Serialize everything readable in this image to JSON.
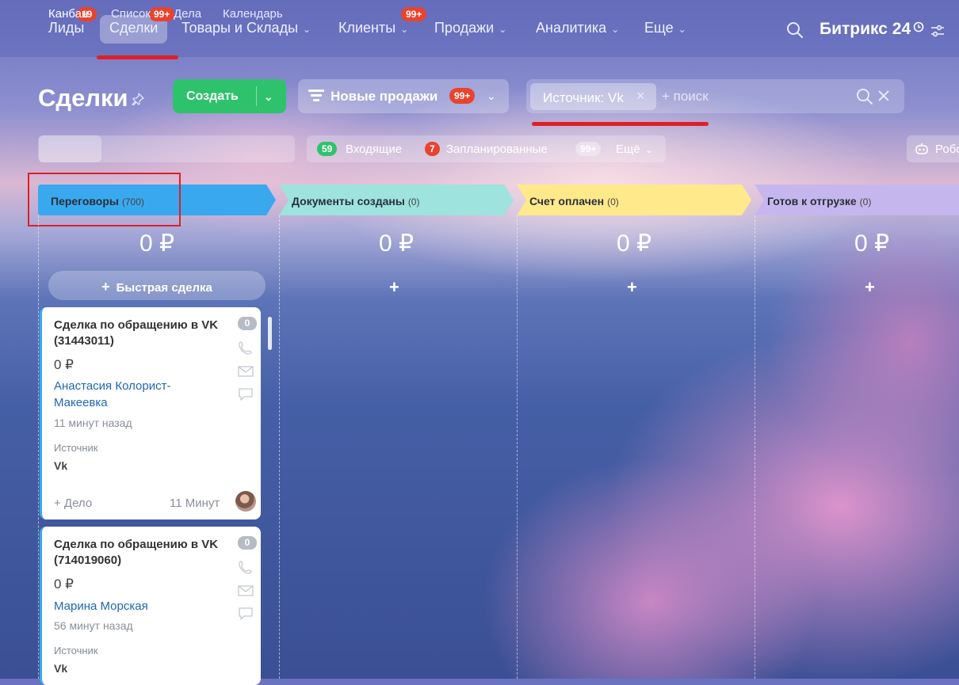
{
  "nav": {
    "items": [
      {
        "label": "Лиды",
        "badge": "19",
        "chevron": false
      },
      {
        "label": "Сделки",
        "badge": "99+",
        "chevron": false,
        "active": true
      },
      {
        "label": "Товары и Склады",
        "badge": "",
        "chevron": true
      },
      {
        "label": "Клиенты",
        "badge": "99+",
        "chevron": true
      },
      {
        "label": "Продажи",
        "badge": "",
        "chevron": true
      },
      {
        "label": "Аналитика",
        "badge": "",
        "chevron": true
      },
      {
        "label": "Еще",
        "badge": "",
        "chevron": true
      }
    ],
    "logo": "Битрикс 24",
    "icons": [
      "search-icon",
      "clock-icon",
      "settings-sliders-icon"
    ]
  },
  "toolbar": {
    "title": "Сделки",
    "create_label": "Создать",
    "funnel_label": "Новые продажи",
    "funnel_badge": "99+",
    "filter_tag": "Источник: Vk",
    "search_placeholder": "+ поиск"
  },
  "views": {
    "tabs": [
      "Канбан",
      "Список",
      "Дела",
      "Календарь"
    ],
    "active": "Канбан"
  },
  "counters": {
    "incoming_count": "59",
    "incoming_label": "Входящие",
    "planned_count": "7",
    "planned_label": "Запланированные",
    "more_count": "99+",
    "more_label": "Ещё",
    "robots_label": "Робо"
  },
  "stages": [
    {
      "name": "Переговоры",
      "count": "(700)",
      "sum": "0 ₽",
      "color": "#39a8ef"
    },
    {
      "name": "Документы созданы",
      "count": "(0)",
      "sum": "0 ₽",
      "color": "#9ee3dd"
    },
    {
      "name": "Счет оплачен",
      "count": "(0)",
      "sum": "0 ₽",
      "color": "#ffe98a"
    },
    {
      "name": "Готов к отгрузке",
      "count": "(0)",
      "sum": "0 ₽",
      "color": "#c6b6ee"
    }
  ],
  "quick_deal_label": "Быстрая сделка",
  "cards": [
    {
      "title": "Сделка по обращению в VK (31443011)",
      "counter": "0",
      "sum": "0 ₽",
      "contact": "Анастасия Колорист-Макеевка",
      "time": "11 минут назад",
      "field_label": "Источник",
      "field_value": "Vk",
      "action": "+ Дело",
      "ago": "11 Минут"
    },
    {
      "title": "Сделка по обращению в VK (714019060)",
      "counter": "0",
      "sum": "0 ₽",
      "contact": "Марина Морская",
      "time": "56 минут назад",
      "field_label": "Источник",
      "field_value": "Vk"
    }
  ],
  "colors": {
    "accent_red": "#e01e26",
    "badge_red": "#e8432e",
    "create_green": "#2fc26c",
    "counter_green": "#2fc26c"
  }
}
